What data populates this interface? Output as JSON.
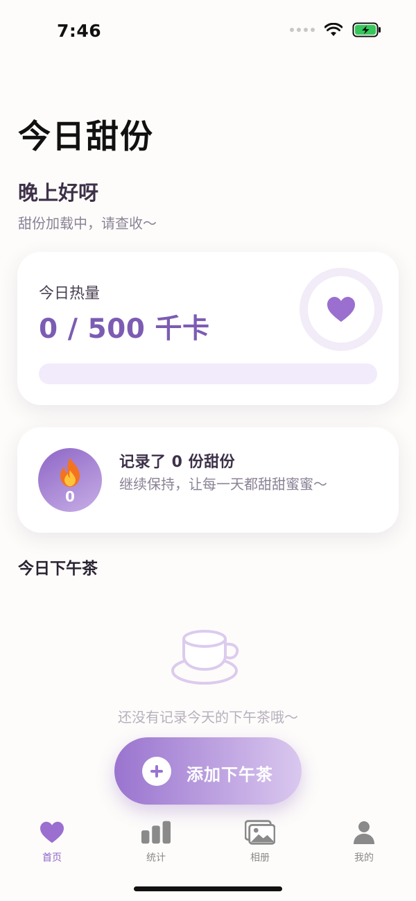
{
  "status_bar": {
    "time": "7:46"
  },
  "page": {
    "title": "今日甜份",
    "greeting": "晚上好呀",
    "sub_greeting": "甜份加载中，请查收～"
  },
  "calorie_card": {
    "label": "今日热量",
    "value": "0 / 500 千卡",
    "progress": 0,
    "icon": "heart-icon"
  },
  "streak_card": {
    "badge_icon": "flame-icon",
    "badge_count": "0",
    "title": "记录了 0 份甜份",
    "description": "继续保持，让每一天都甜甜蜜蜜～"
  },
  "afternoon_tea": {
    "section_title": "今日下午茶",
    "empty_icon": "teacup-icon",
    "empty_text": "还没有记录今天的下午茶哦～"
  },
  "add_button": {
    "label": "添加下午茶",
    "icon": "plus-icon"
  },
  "tab_bar": {
    "tabs": [
      {
        "label": "首页",
        "icon": "heart-icon",
        "active": true
      },
      {
        "label": "统计",
        "icon": "bar-chart-icon",
        "active": false
      },
      {
        "label": "相册",
        "icon": "photo-album-icon",
        "active": false
      },
      {
        "label": "我的",
        "icon": "person-icon",
        "active": false
      }
    ]
  },
  "colors": {
    "accent": "#7c5cb3",
    "accent_light": "#f1ebfb",
    "tab_active": "#8f64c8",
    "tab_inactive": "#8a8a8a",
    "battery": "#34c759"
  }
}
